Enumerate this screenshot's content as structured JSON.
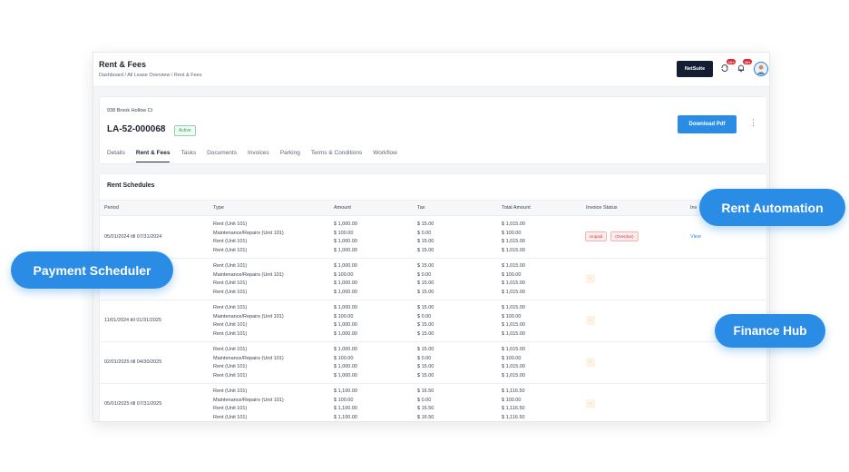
{
  "app": {
    "page_title": "Rent & Fees",
    "breadcrumb": [
      "Dashboard",
      "All Lease Overview",
      "Rent & Fees"
    ],
    "breadcrumb_separator": "/",
    "netsuite_label": "NetSuite",
    "icons": [
      {
        "name": "sync-icon",
        "badge": "10+"
      },
      {
        "name": "bell-icon",
        "badge": "10+"
      }
    ],
    "avatar_icon": "user-avatar"
  },
  "lease": {
    "address": "938 Brook Hollow Ct",
    "id": "LA-52-000068",
    "status": "Active",
    "download_label": "Download Pdf",
    "more_icon": "vertical-ellipsis-icon"
  },
  "tabs": [
    {
      "label": "Details",
      "active": false
    },
    {
      "label": "Rent & Fees",
      "active": true
    },
    {
      "label": "Tasks",
      "active": false
    },
    {
      "label": "Documents",
      "active": false
    },
    {
      "label": "Invoices",
      "active": false
    },
    {
      "label": "Parking",
      "active": false
    },
    {
      "label": "Terms & Conditions",
      "active": false
    },
    {
      "label": "Workflow",
      "active": false
    }
  ],
  "schedule": {
    "title": "Rent Schedules",
    "columns": [
      "Period",
      "Type",
      "Amount",
      "Tax",
      "Total Amount",
      "Invoice Status",
      "Inv"
    ],
    "rows": [
      {
        "period": "05/01/2024 till 07/31/2024",
        "types": [
          "Rent (Unit 101)",
          "Maintenance/Repairs (Unit 101)",
          "Rent (Unit 101)",
          "Rent (Unit 101)"
        ],
        "amounts": [
          "$ 1,000.00",
          "$ 100.00",
          "$ 1,000.00",
          "$ 1,000.00"
        ],
        "taxes": [
          "$ 15.00",
          "$ 0.00",
          "$ 15.00",
          "$ 15.00"
        ],
        "totals": [
          "$ 1,015.00",
          "$ 100.00",
          "$ 1,015.00",
          "$ 1,015.00"
        ],
        "status_tags": [
          "Unpaid",
          "(Overdue)"
        ],
        "action": "View"
      },
      {
        "period": "",
        "types": [
          "Rent (Unit 101)",
          "Maintenance/Repairs (Unit 101)",
          "Rent (Unit 101)",
          "Rent (Unit 101)"
        ],
        "amounts": [
          "$ 1,000.00",
          "$ 100.00",
          "$ 1,000.00",
          "$ 1,000.00"
        ],
        "taxes": [
          "$ 15.00",
          "$ 0.00",
          "$ 15.00",
          "$ 15.00"
        ],
        "totals": [
          "$ 1,015.00",
          "$ 100.00",
          "$ 1,015.00",
          "$ 1,015.00"
        ],
        "status_dash": "-"
      },
      {
        "period": "11/01/2024 till 01/31/2025",
        "types": [
          "Rent (Unit 101)",
          "Maintenance/Repairs (Unit 101)",
          "Rent (Unit 101)",
          "Rent (Unit 101)"
        ],
        "amounts": [
          "$ 1,000.00",
          "$ 100.00",
          "$ 1,000.00",
          "$ 1,000.00"
        ],
        "taxes": [
          "$ 15.00",
          "$ 0.00",
          "$ 15.00",
          "$ 15.00"
        ],
        "totals": [
          "$ 1,015.00",
          "$ 100.00",
          "$ 1,015.00",
          "$ 1,015.00"
        ],
        "status_dash": "-"
      },
      {
        "period": "02/01/2025 till 04/30/2025",
        "types": [
          "Rent (Unit 101)",
          "Maintenance/Repairs (Unit 101)",
          "Rent (Unit 101)",
          "Rent (Unit 101)"
        ],
        "amounts": [
          "$ 1,000.00",
          "$ 100.00",
          "$ 1,000.00",
          "$ 1,000.00"
        ],
        "taxes": [
          "$ 15.00",
          "$ 0.00",
          "$ 15.00",
          "$ 15.00"
        ],
        "totals": [
          "$ 1,015.00",
          "$ 100.00",
          "$ 1,015.00",
          "$ 1,015.00"
        ],
        "status_dash": "-"
      },
      {
        "period": "05/01/2025 till 07/31/2025",
        "types": [
          "Rent (Unit 101)",
          "Maintenance/Repairs (Unit 101)",
          "Rent (Unit 101)",
          "Rent (Unit 101)"
        ],
        "amounts": [
          "$ 1,100.00",
          "$ 100.00",
          "$ 1,100.00",
          "$ 1,100.00"
        ],
        "taxes": [
          "$ 16.50",
          "$ 0.00",
          "$ 16.50",
          "$ 16.50"
        ],
        "totals": [
          "$ 1,116.50",
          "$ 100.00",
          "$ 1,116.50",
          "$ 1,116.50"
        ],
        "status_dash": "-"
      }
    ]
  },
  "callouts": {
    "rent_automation": "Rent Automation",
    "payment_scheduler": "Payment Scheduler",
    "finance_hub": "Finance Hub"
  },
  "colors": {
    "accent": "#2b8ce6",
    "navy": "#141e33",
    "danger": "#e0262f",
    "success": "#2aa657"
  }
}
